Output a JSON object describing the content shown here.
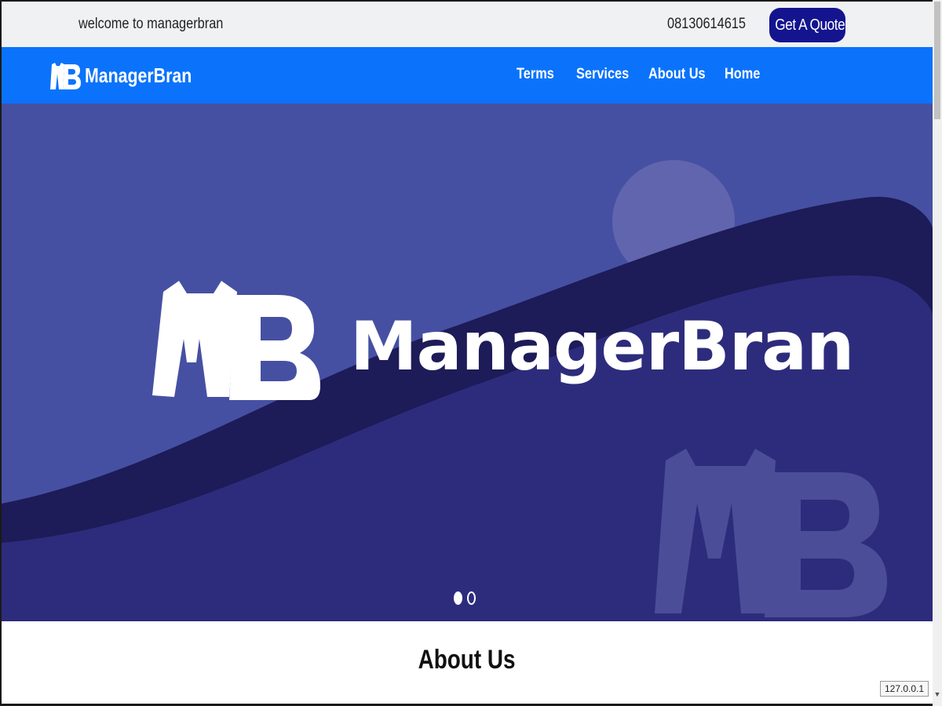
{
  "topbar": {
    "welcome_text": "welcome to managerbran",
    "phone": "08130614615",
    "quote_button": "Get A Quote"
  },
  "navbar": {
    "brand_name": "ManagerBran",
    "links": [
      "Terms",
      "Services",
      "About Us",
      "Home"
    ]
  },
  "hero": {
    "title": "ManagerBran",
    "slides": 2,
    "active_slide": 1,
    "colors": {
      "background": "#4650a2",
      "wave_dark": "#1d1b58",
      "wave_fill": "#2d2c7c"
    }
  },
  "about": {
    "heading": "About Us"
  },
  "status": {
    "url_tooltip": "127.0.0.1"
  },
  "colors": {
    "nav_bar": "#0b73fb",
    "quote_button": "#14148f",
    "top_bar": "#f0f1f3"
  }
}
